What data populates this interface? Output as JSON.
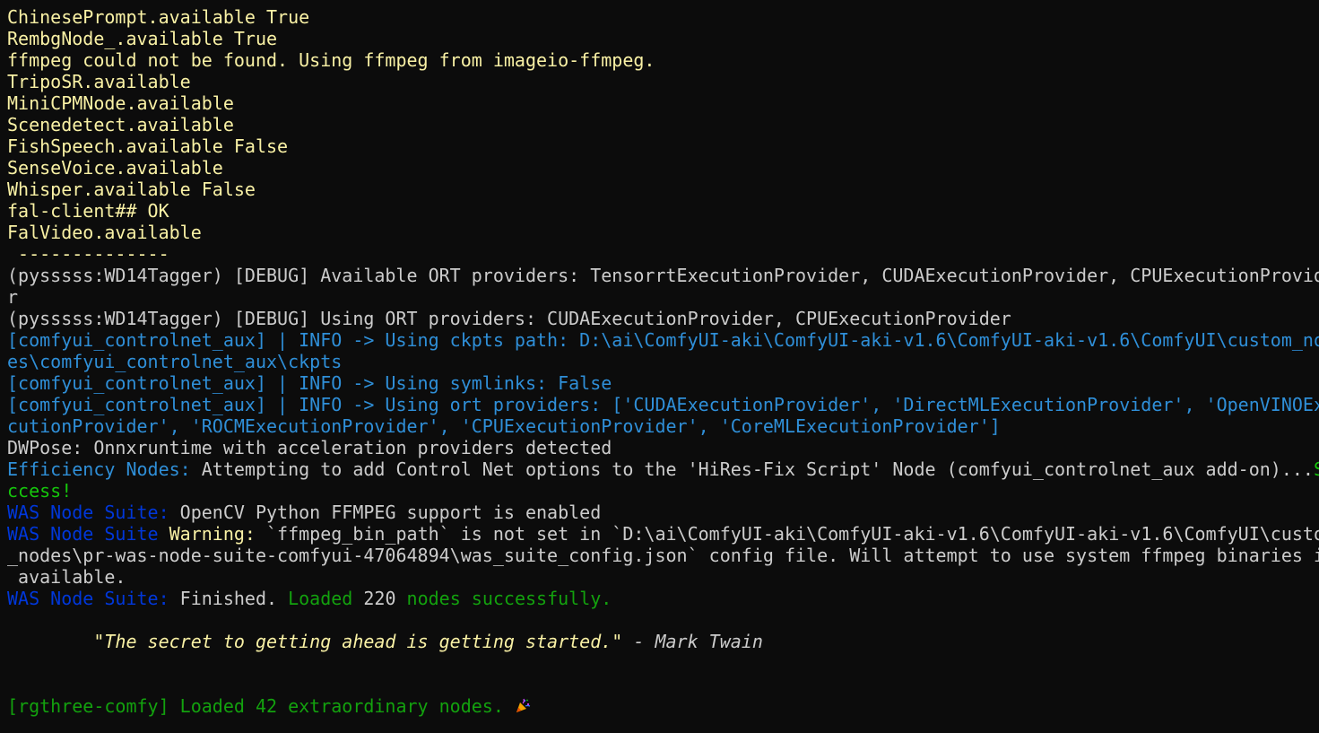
{
  "colors": {
    "background": "#0c0c0c",
    "yellow": "#f9f1a5",
    "gray": "#cccccc",
    "blue": "#3b78ff",
    "cyan_blue": "#2f8fd8",
    "green": "#16c60c",
    "dark_green": "#13a10e",
    "dark_blue": "#0037da"
  },
  "lines": [
    {
      "segs": [
        {
          "t": "ChinesePrompt.available True",
          "c": "#f9f1a5"
        }
      ]
    },
    {
      "segs": [
        {
          "t": "RembgNode_.available True",
          "c": "#f9f1a5"
        }
      ]
    },
    {
      "segs": [
        {
          "t": "ffmpeg could not be found. Using ffmpeg from imageio-ffmpeg.",
          "c": "#f9f1a5"
        }
      ]
    },
    {
      "segs": [
        {
          "t": "TripoSR.available",
          "c": "#f9f1a5"
        }
      ]
    },
    {
      "segs": [
        {
          "t": "MiniCPMNode.available",
          "c": "#f9f1a5"
        }
      ]
    },
    {
      "segs": [
        {
          "t": "Scenedetect.available",
          "c": "#f9f1a5"
        }
      ]
    },
    {
      "segs": [
        {
          "t": "FishSpeech.available False",
          "c": "#f9f1a5"
        }
      ]
    },
    {
      "segs": [
        {
          "t": "SenseVoice.available",
          "c": "#f9f1a5"
        }
      ]
    },
    {
      "segs": [
        {
          "t": "Whisper.available False",
          "c": "#f9f1a5"
        }
      ]
    },
    {
      "segs": [
        {
          "t": "fal-client## OK",
          "c": "#f9f1a5"
        }
      ]
    },
    {
      "segs": [
        {
          "t": "FalVideo.available",
          "c": "#f9f1a5"
        }
      ]
    },
    {
      "segs": [
        {
          "t": " --------------",
          "c": "#f9f1a5"
        }
      ]
    },
    {
      "segs": [
        {
          "t": "(pysssss:WD14Tagger) [DEBUG] Available ORT providers: TensorrtExecutionProvider, CUDAExecutionProvider, CPUExecutionProvide",
          "c": "#cccccc"
        }
      ]
    },
    {
      "segs": [
        {
          "t": "r",
          "c": "#cccccc"
        }
      ]
    },
    {
      "segs": [
        {
          "t": "(pysssss:WD14Tagger) [DEBUG] Using ORT providers: CUDAExecutionProvider, CPUExecutionProvider",
          "c": "#cccccc"
        }
      ]
    },
    {
      "segs": [
        {
          "t": "[comfyui_controlnet_aux] | INFO -> Using ckpts path: D:\\ai\\ComfyUI-aki\\ComfyUI-aki-v1.6\\ComfyUI-aki-v1.6\\ComfyUI\\custom_nod",
          "c": "#2f8fd8"
        }
      ]
    },
    {
      "segs": [
        {
          "t": "es\\comfyui_controlnet_aux\\ckpts",
          "c": "#2f8fd8"
        }
      ]
    },
    {
      "segs": [
        {
          "t": "[comfyui_controlnet_aux] | INFO -> Using symlinks: False",
          "c": "#2f8fd8"
        }
      ]
    },
    {
      "segs": [
        {
          "t": "[comfyui_controlnet_aux] | INFO -> Using ort providers: ['CUDAExecutionProvider', 'DirectMLExecutionProvider', 'OpenVINOExe",
          "c": "#2f8fd8"
        }
      ]
    },
    {
      "segs": [
        {
          "t": "cutionProvider', 'ROCMExecutionProvider', 'CPUExecutionProvider', 'CoreMLExecutionProvider']",
          "c": "#2f8fd8"
        }
      ]
    },
    {
      "segs": [
        {
          "t": "DWPose: Onnxruntime with acceleration providers detected",
          "c": "#cccccc"
        }
      ]
    },
    {
      "segs": [
        {
          "t": "Efficiency Nodes:",
          "c": "#2f8fd8"
        },
        {
          "t": " Attempting to add Control Net options to the 'HiRes-Fix Script' Node (comfyui_controlnet_aux add-on)...",
          "c": "#cccccc"
        },
        {
          "t": "Su",
          "c": "#16c60c"
        }
      ]
    },
    {
      "segs": [
        {
          "t": "ccess!",
          "c": "#16c60c"
        }
      ]
    },
    {
      "segs": [
        {
          "t": "WAS Node Suite:",
          "c": "#0037da"
        },
        {
          "t": " OpenCV Python FFMPEG support is enabled",
          "c": "#cccccc"
        }
      ]
    },
    {
      "segs": [
        {
          "t": "WAS Node Suite",
          "c": "#0037da"
        },
        {
          "t": " Warning:",
          "c": "#f9f1a5"
        },
        {
          "t": " `ffmpeg_bin_path` is not set in `D:\\ai\\ComfyUI-aki\\ComfyUI-aki-v1.6\\ComfyUI-aki-v1.6\\ComfyUI\\custom",
          "c": "#cccccc"
        }
      ]
    },
    {
      "segs": [
        {
          "t": "_nodes\\pr-was-node-suite-comfyui-47064894\\was_suite_config.json` config file. Will attempt to use system ffmpeg binaries if",
          "c": "#cccccc"
        }
      ]
    },
    {
      "segs": [
        {
          "t": " available.",
          "c": "#cccccc"
        }
      ]
    },
    {
      "segs": [
        {
          "t": "WAS Node Suite:",
          "c": "#0037da"
        },
        {
          "t": " Finished.",
          "c": "#cccccc"
        },
        {
          "t": " Loaded",
          "c": "#13a10e"
        },
        {
          "t": " 220",
          "c": "#cccccc"
        },
        {
          "t": " nodes successfully.",
          "c": "#13a10e"
        }
      ]
    },
    {
      "segs": [
        {
          "t": "",
          "c": "#cccccc"
        }
      ]
    },
    {
      "segs": [
        {
          "t": "        \"The secret to getting ahead is getting started.\"",
          "c": "#f9f1a5",
          "i": true
        },
        {
          "t": " - Mark Twain",
          "c": "#cccccc",
          "i": true
        }
      ]
    },
    {
      "segs": [
        {
          "t": "",
          "c": "#cccccc"
        }
      ]
    },
    {
      "segs": [
        {
          "t": "",
          "c": "#cccccc"
        }
      ]
    },
    {
      "segs": [
        {
          "t": "[rgthree-comfy] Loaded 42 extraordinary nodes.",
          "c": "#13a10e"
        },
        {
          "t": " ",
          "c": "#cccccc"
        }
      ],
      "icon": "party-popper-icon"
    }
  ]
}
